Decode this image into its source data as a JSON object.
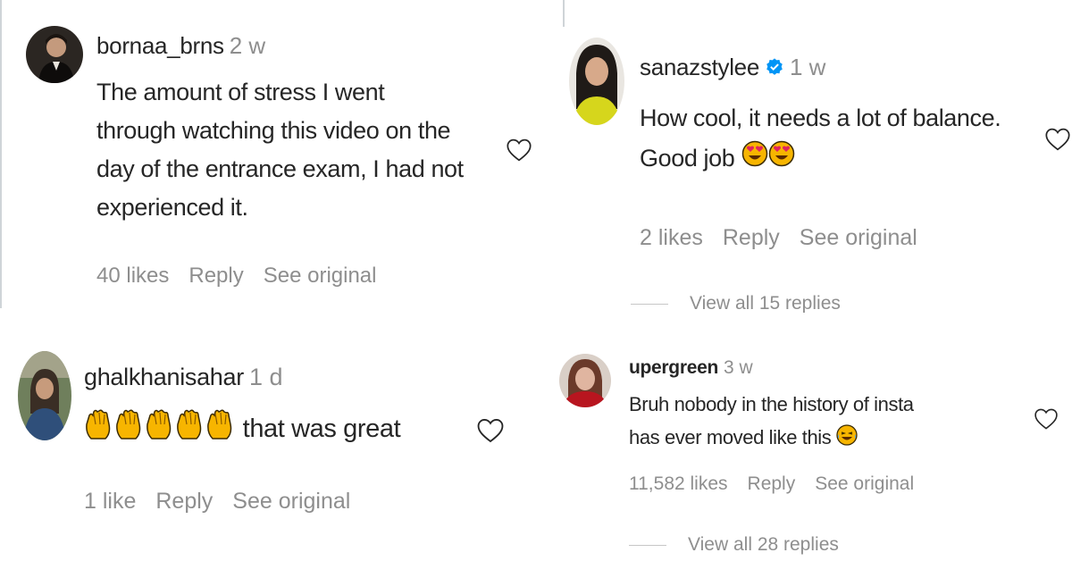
{
  "comments": [
    {
      "username": "bornaa_brns",
      "time": "2 w",
      "text_lines": [
        "The amount of stress I went",
        "through watching this video on the",
        "day of the entrance exam, I had not",
        "experienced it."
      ],
      "likes": "40 likes",
      "reply": "Reply",
      "see_original": "See original",
      "avatar_icon": "avatar-man-dark"
    },
    {
      "username": "sanazstylee",
      "verified": true,
      "time": "1 w",
      "text_lines": [
        "How cool, it needs a lot of balance.",
        "Good job"
      ],
      "emojis": [
        "heart-eyes",
        "heart-eyes"
      ],
      "likes": "2 likes",
      "reply": "Reply",
      "see_original": "See original",
      "view_replies": "View all 15 replies",
      "avatar_icon": "avatar-woman-yellow"
    },
    {
      "username": "ghalkhanisahar",
      "time": "1 d",
      "text": "that was great",
      "emojis": [
        "clap",
        "clap",
        "clap",
        "clap",
        "clap"
      ],
      "likes": "1 like",
      "reply": "Reply",
      "see_original": "See original",
      "avatar_icon": "avatar-woman-blue"
    },
    {
      "username": "upergreen",
      "time": "3 w",
      "text_lines": [
        "Bruh nobody in the history of insta",
        "has ever moved like this"
      ],
      "emojis": [
        "laughing"
      ],
      "likes": "11,582 likes",
      "reply": "Reply",
      "see_original": "See original",
      "view_replies": "View all 28 replies",
      "avatar_icon": "avatar-woman-red"
    }
  ],
  "colors": {
    "text": "#262626",
    "meta": "#8e8e8e",
    "verified": "#0095f6",
    "emoji": "#f7b500"
  }
}
